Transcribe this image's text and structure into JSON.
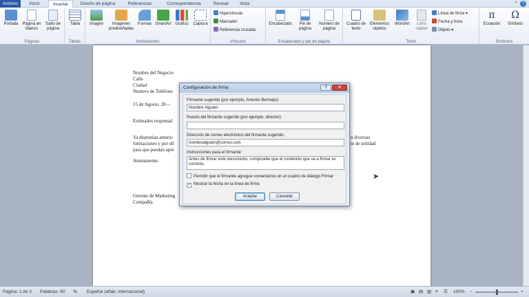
{
  "tabs": [
    {
      "label": "Archivo",
      "kind": "file"
    },
    {
      "label": "Inicio",
      "kind": "normal"
    },
    {
      "label": "Insertar",
      "kind": "active"
    },
    {
      "label": "Diseño de página",
      "kind": "normal"
    },
    {
      "label": "Referencias",
      "kind": "normal"
    },
    {
      "label": "Correspondencia",
      "kind": "normal"
    },
    {
      "label": "Revisar",
      "kind": "normal"
    },
    {
      "label": "Vista",
      "kind": "normal"
    }
  ],
  "help": "?",
  "minimize_ribbon": "⌃",
  "ribbon": {
    "paginas": {
      "label": "Páginas",
      "portada": "Portada",
      "pagina_blanco": "Página en blanco",
      "salto_pagina": "Salto de página"
    },
    "tablas": {
      "label": "Tablas",
      "tabla": "Tabla"
    },
    "ilustraciones": {
      "label": "Ilustraciones",
      "imagen": "Imagen",
      "imagenes_predisenadas": "Imágenes prediseñadas",
      "formas": "Formas",
      "smartart": "SmartArt",
      "grafico": "Gráfico",
      "captura": "Captura"
    },
    "vinculos": {
      "label": "Vínculos",
      "hipervinculo": "Hipervínculo",
      "marcador": "Marcador",
      "referencia_cruzada": "Referencia cruzada"
    },
    "encabezado_pie": {
      "label": "Encabezado y pie de página",
      "encabezado": "Encabezado",
      "pie_pagina": "Pie de página",
      "numero_pagina": "Número de página"
    },
    "texto": {
      "label": "Texto",
      "cuadro_texto": "Cuadro de texto",
      "elementos_rapidos": "Elementos rápidos",
      "wordart": "WordArt",
      "letra_capital": "Letra capital",
      "linea_firma": "Línea de firma",
      "fecha_hora": "Fecha y hora",
      "objeto": "Objeto"
    },
    "simbolos": {
      "label": "Símbolos",
      "ecuacion": "Ecuación",
      "simbolo": "Símbolo"
    }
  },
  "document": {
    "lines": [
      "Nombre del Negocio",
      "Calle",
      "Ciudad",
      "Numero de Teléfono",
      "15 de Agosto, 20—",
      "Estimados responsal",
      "Ya disponían anterio",
      "formaciones y por ell",
      "para que puedan apre",
      "Atentamente.",
      "Gerente de Marketing",
      "Compañía"
    ],
    "right_fragments": [
      "n diversas",
      "te de utilidad"
    ]
  },
  "dialog": {
    "title": "Configuración de firma",
    "help": "?",
    "close": "✕",
    "fields": {
      "firmante_label": "Firmante sugerido (por ejemplo, Antonio Bermejo):",
      "firmante_value": "Nombre Alguien",
      "puesto_label": "Puesto del firmante sugerido (por ejemplo, director):",
      "puesto_value": "",
      "correo_label": "Dirección de correo electrónico del firmante sugerido:",
      "correo_value": "nombrealguien@correo.com",
      "instrucciones_label": "Instrucciones para el firmante:",
      "instrucciones_value": "Antes de firmar este documento, compruebe que el contenido que va a firmar es correcto."
    },
    "checks": {
      "permitir_label": "Permitir que el firmante agregue comentarios en el cuadro de diálogo Firmar",
      "permitir_checked": false,
      "mostrar_label": "Mostrar la fecha en la línea de firma",
      "mostrar_checked": true
    },
    "accept": "Aceptar",
    "cancel": "Cancelar"
  },
  "status": {
    "pagina": "Página: 1 de 3",
    "palabras": "Palabras: 60",
    "idioma": "Español (alfab. internacional)",
    "zoom": "100%",
    "zoom_fraction": 0.5
  },
  "colors": {
    "accent": "#2a5aa8",
    "close_button": "#c9483a"
  }
}
